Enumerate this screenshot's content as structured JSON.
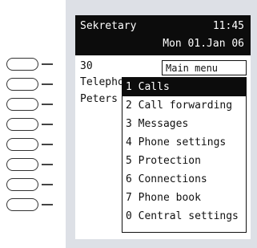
{
  "status": {
    "name": "Sekretary",
    "time": "11:45",
    "date": "Mon 01.Jan 06"
  },
  "background_lines": [
    "30",
    "Telepho",
    "Peters"
  ],
  "menu": {
    "title": "Main  menu",
    "selected_index": 0,
    "items": [
      {
        "label": "1 Calls"
      },
      {
        "label": "2 Call forwarding"
      },
      {
        "label": "3 Messages"
      },
      {
        "label": "4 Phone settings"
      },
      {
        "label": "5 Protection"
      },
      {
        "label": "6 Connections"
      },
      {
        "label": "7 Phone book"
      },
      {
        "label": "0 Central settings"
      }
    ]
  },
  "softkeys_count": 8,
  "colors": {
    "bezel": "#dde0e6",
    "highlight": "#0c0c0c"
  }
}
